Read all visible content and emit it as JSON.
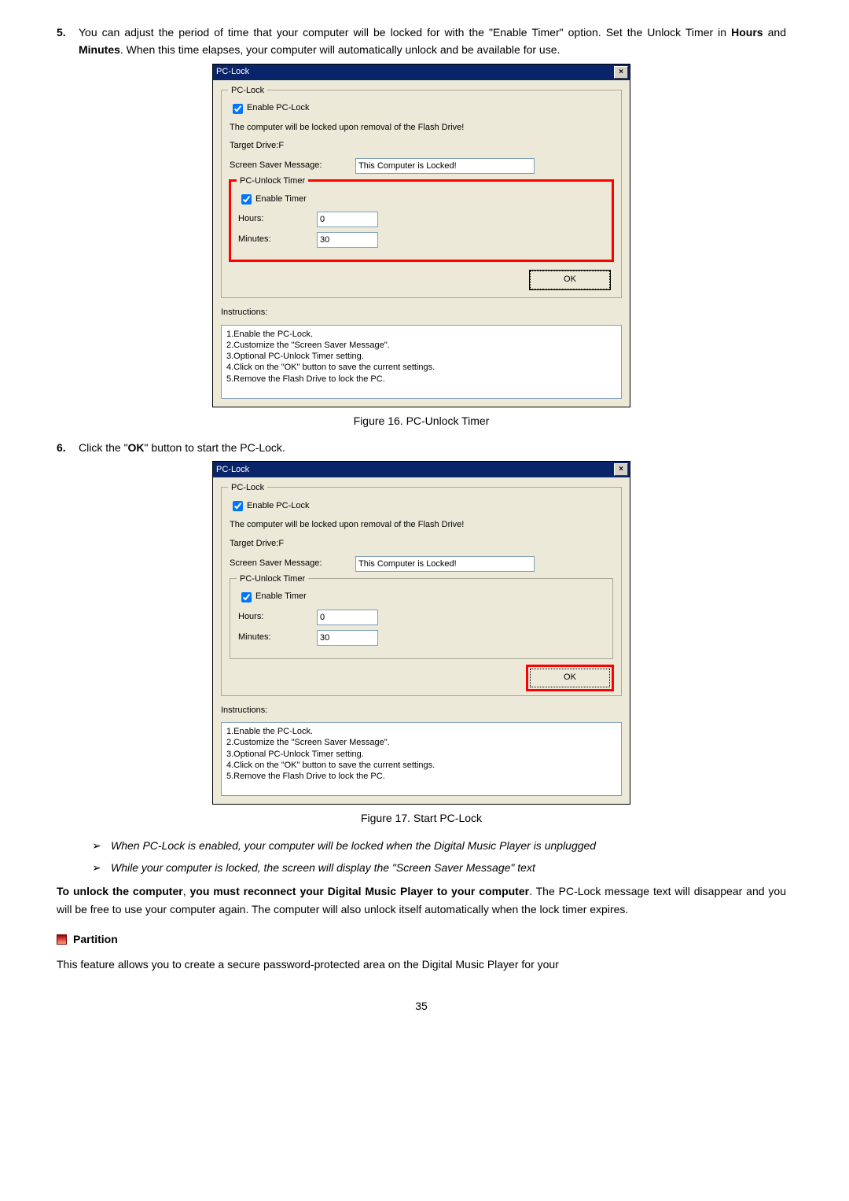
{
  "li5": {
    "num": "5.",
    "pre": "You can adjust the period of time that your computer will be locked for with the \"Enable Timer\" option. Set the Unlock Timer in ",
    "hours": "Hours",
    "and": " and ",
    "minutes": "Minutes",
    "post": ". When this time elapses, your computer will automatically unlock and be available for use."
  },
  "li6": {
    "num": "6.",
    "pre": "Click the \"",
    "ok": "OK",
    "post": "\" button to start the PC-Lock."
  },
  "dialog": {
    "title": "PC-Lock",
    "close": "×",
    "gb1_label": "PC-Lock",
    "enable_pclock": "Enable PC-Lock",
    "locked_msg": "The computer will be locked upon removal of the Flash Drive!",
    "target_drive": "Target Drive:F",
    "ssm_label": "Screen Saver Message:",
    "ssm_value": "This Computer is Locked!",
    "timer_label": "PC-Unlock Timer",
    "enable_timer": "Enable Timer",
    "hours_label": "Hours:",
    "hours_value": "0",
    "minutes_label": "Minutes:",
    "minutes_value": "30",
    "ok_label": "OK",
    "instr_label": "Instructions:",
    "instr_text": "1.Enable the PC-Lock.\n2.Customize the \"Screen Saver Message\".\n3.Optional PC-Unlock Timer setting.\n4.Click on the \"OK\" button to save the current settings.\n5.Remove the Flash Drive to lock the PC."
  },
  "fig16": "Figure 16. PC-Unlock Timer",
  "fig17": "Figure 17. Start PC-Lock",
  "bullet1": "When PC-Lock is enabled, your computer will be locked when the Digital Music Player is unplugged",
  "bullet2": "While your computer is locked, the screen will display the \"Screen Saver Message\" text",
  "unlock_para": {
    "b1": "To unlock the computer",
    "mid": ", ",
    "b2": "you must reconnect your Digital Music Player to your computer",
    "rest": ". The PC-Lock message text will disappear and you will be free to use your computer again. The computer will also unlock itself automatically when the lock timer expires."
  },
  "partition_title": "Partition",
  "partition_para": "This feature allows you to create a secure password-protected area on the Digital Music Player for your",
  "page_num": "35",
  "arrow": "➢"
}
